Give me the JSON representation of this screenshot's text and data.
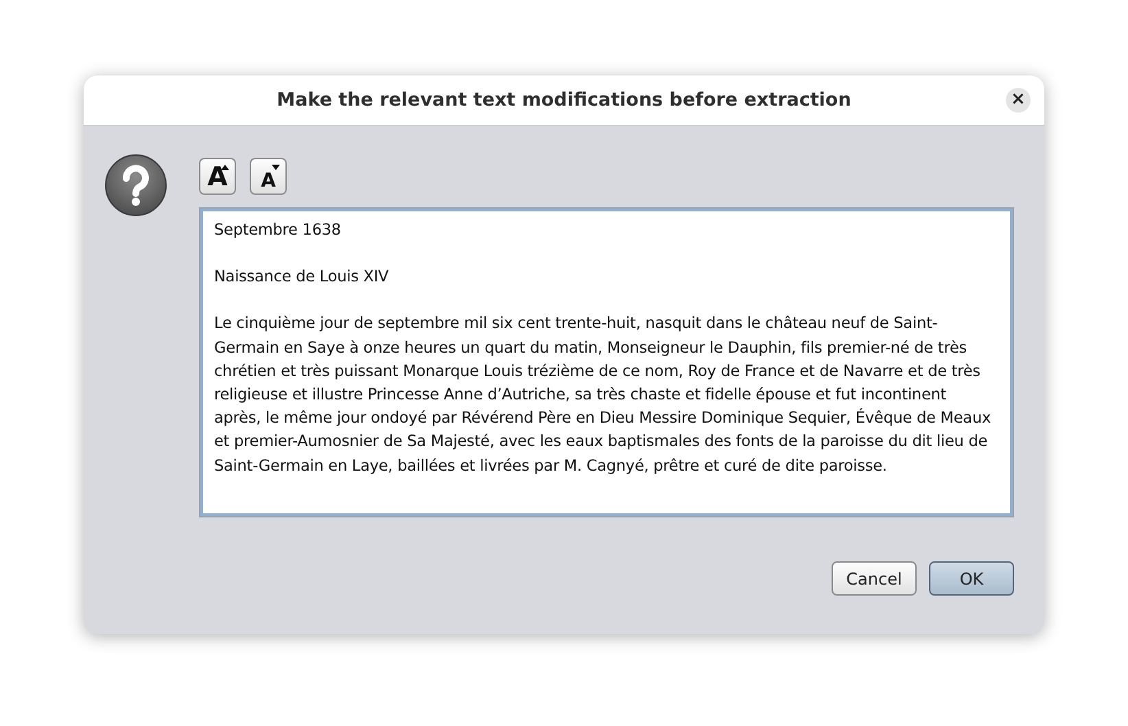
{
  "window": {
    "title": "Make the relevant text modifications before extraction",
    "close": "×"
  },
  "font_buttons": [
    {
      "kind": "increase",
      "label": "A"
    },
    {
      "kind": "decrease",
      "label": "A"
    }
  ],
  "text_area": {
    "paragraphs": [
      "Septembre 1638",
      "Naissance de Louis XIV",
      "Le cinquième jour de septembre mil six cent trente-huit, nasquit dans le château neuf de Saint-Germain en Saye à onze heures un quart du matin, Monseigneur le Dauphin, fils premier-né de très chrétien et très puissant Monarque Louis trézième de ce nom, Roy de France et de Navarre et de très religieuse et illustre Princesse Anne d’Autriche, sa très chaste et fidelle épouse et fut incontinent après, le même jour ondoyé par Révérend Père en Dieu Messire Dominique Sequier, Évêque de Meaux et premier-Aumosnier de Sa Majesté, avec les eaux baptismales des fonts de la paroisse du dit lieu de Saint-Germain en Laye, baillées et livrées par M. Cagnyé, prêtre et curé de dite paroisse."
    ]
  },
  "buttons": [
    {
      "label": "Cancel",
      "kind": "normal"
    },
    {
      "label": "OK",
      "kind": "default"
    }
  ]
}
